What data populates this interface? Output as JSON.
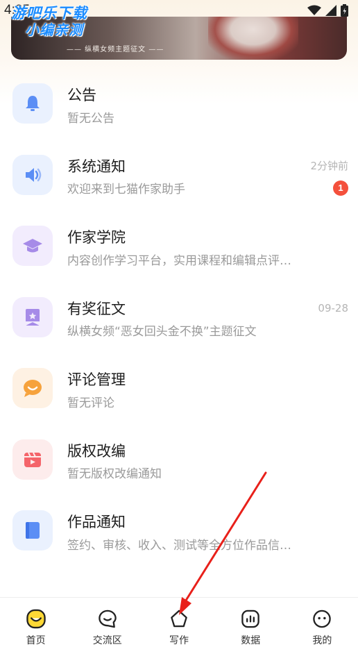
{
  "status_bar": {
    "time": "4:25"
  },
  "watermark": {
    "line1": "游吧乐下载",
    "line2": "小编亲测"
  },
  "banner": {
    "caption": "—— 纵横女频主题征文 ——"
  },
  "messages": [
    {
      "title": "公告",
      "subtitle": "暂无公告",
      "time": "",
      "badge": "",
      "icon": "bell-icon",
      "icon_bg": "#eaf1fe",
      "icon_color": "#5b8ef5"
    },
    {
      "title": "系统通知",
      "subtitle": "欢迎来到七猫作家助手",
      "time": "2分钟前",
      "badge": "1",
      "icon": "speaker-icon",
      "icon_bg": "#eaf1fe",
      "icon_color": "#5b8ef5"
    },
    {
      "title": "作家学院",
      "subtitle": "内容创作学习平台，实用课程和编辑点评…",
      "time": "",
      "badge": "",
      "icon": "graduation-cap-icon",
      "icon_bg": "#f2ecfd",
      "icon_color": "#a68be8"
    },
    {
      "title": "有奖征文",
      "subtitle": "纵横女频“恶女回头金不换”主题征文",
      "time": "09-28",
      "badge": "",
      "icon": "bookmark-star-icon",
      "icon_bg": "#f2ecfd",
      "icon_color": "#a68be8"
    },
    {
      "title": "评论管理",
      "subtitle": "暂无评论",
      "time": "",
      "badge": "",
      "icon": "comment-bubble-icon",
      "icon_bg": "#fef1e3",
      "icon_color": "#f6a23c"
    },
    {
      "title": "版权改编",
      "subtitle": "暂无版权改编通知",
      "time": "",
      "badge": "",
      "icon": "video-clapper-icon",
      "icon_bg": "#fdecec",
      "icon_color": "#f4646a"
    },
    {
      "title": "作品通知",
      "subtitle": "签约、审核、收入、测试等全方位作品信…",
      "time": "",
      "badge": "",
      "icon": "book-icon",
      "icon_bg": "#eaf1fe",
      "icon_color": "#5b8ef5"
    }
  ],
  "tabs": [
    {
      "label": "首页",
      "icon": "home-face-icon",
      "active": true
    },
    {
      "label": "交流区",
      "icon": "chat-icon",
      "active": false
    },
    {
      "label": "写作",
      "icon": "pen-nib-icon",
      "active": false
    },
    {
      "label": "数据",
      "icon": "chart-bars-icon",
      "active": false
    },
    {
      "label": "我的",
      "icon": "profile-face-icon",
      "active": false
    }
  ],
  "colors": {
    "accent_yellow": "#fdd835",
    "badge_red": "#f4503c",
    "annotation_arrow": "#e8201a"
  }
}
